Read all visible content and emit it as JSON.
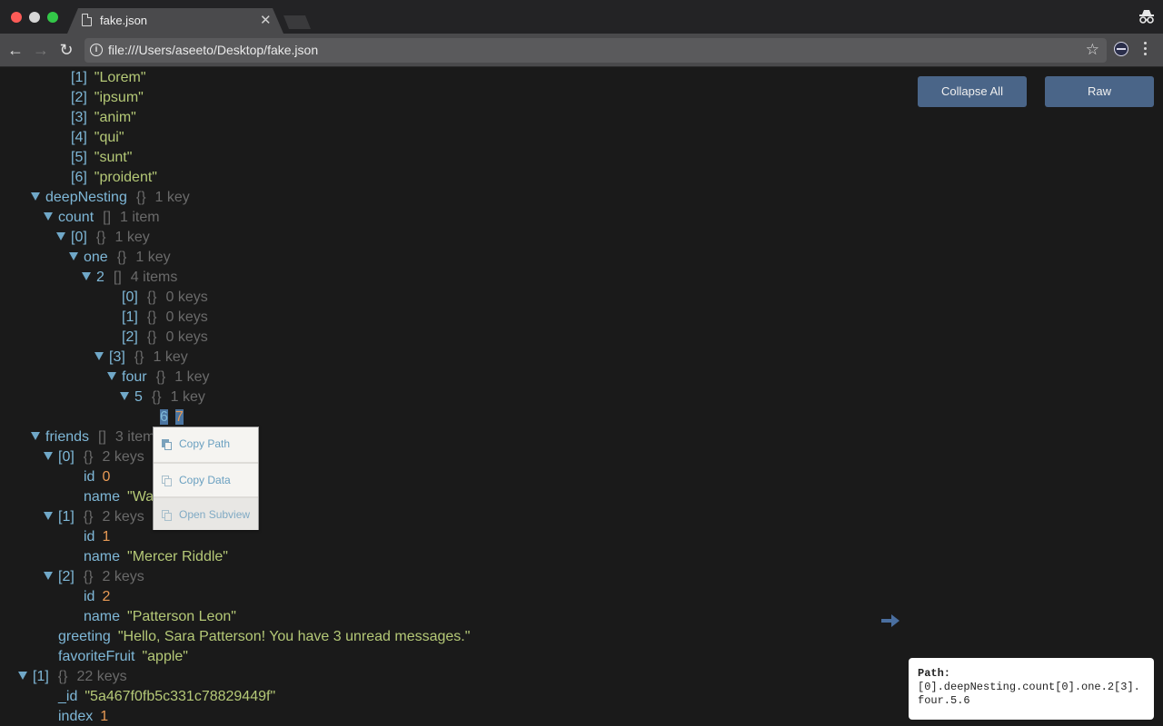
{
  "browser": {
    "tab_title": "fake.json",
    "url": "file:///Users/aseeto/Desktop/fake.json",
    "icons": [
      "back-arrow-icon",
      "forward-arrow-icon",
      "reload-icon",
      "info-icon",
      "star-icon",
      "extension-icon",
      "menu-dots-icon",
      "incognito-icon",
      "file-icon",
      "close-icon"
    ]
  },
  "actions": {
    "collapse_all": "Collapse All",
    "raw": "Raw"
  },
  "tree": [
    {
      "indent": 4,
      "caret": false,
      "key": "[1]",
      "value": "\"Lorem\"",
      "vtype": "str"
    },
    {
      "indent": 4,
      "caret": false,
      "key": "[2]",
      "value": "\"ipsum\"",
      "vtype": "str"
    },
    {
      "indent": 4,
      "caret": false,
      "key": "[3]",
      "value": "\"anim\"",
      "vtype": "str"
    },
    {
      "indent": 4,
      "caret": false,
      "key": "[4]",
      "value": "\"qui\"",
      "vtype": "str"
    },
    {
      "indent": 4,
      "caret": false,
      "key": "[5]",
      "value": "\"sunt\"",
      "vtype": "str"
    },
    {
      "indent": 4,
      "caret": false,
      "key": "[6]",
      "value": "\"proident\"",
      "vtype": "str"
    },
    {
      "indent": 2,
      "caret": true,
      "key": "deepNesting",
      "bracket": "{}",
      "count": "1 key"
    },
    {
      "indent": 3,
      "caret": true,
      "key": "count",
      "bracket": "[]",
      "count": "1 item"
    },
    {
      "indent": 4,
      "caret": true,
      "key": "[0]",
      "bracket": "{}",
      "count": "1 key"
    },
    {
      "indent": 5,
      "caret": true,
      "key": "one",
      "bracket": "{}",
      "count": "1 key"
    },
    {
      "indent": 6,
      "caret": true,
      "key": "2",
      "bracket": "[]",
      "count": "4 items"
    },
    {
      "indent": 8,
      "caret": false,
      "key": "[0]",
      "bracket": "{}",
      "count": "0 keys"
    },
    {
      "indent": 8,
      "caret": false,
      "key": "[1]",
      "bracket": "{}",
      "count": "0 keys"
    },
    {
      "indent": 8,
      "caret": false,
      "key": "[2]",
      "bracket": "{}",
      "count": "0 keys"
    },
    {
      "indent": 7,
      "caret": true,
      "key": "[3]",
      "bracket": "{}",
      "count": "1 key"
    },
    {
      "indent": 8,
      "caret": true,
      "key": "four",
      "bracket": "{}",
      "count": "1 key"
    },
    {
      "indent": 9,
      "caret": true,
      "key": "5",
      "bracket": "{}",
      "count": "1 key"
    },
    {
      "indent": 11,
      "caret": false,
      "key": "6",
      "value": "7",
      "vtype": "num",
      "selected": true
    },
    {
      "indent": 2,
      "caret": true,
      "key": "friends",
      "bracket": "[]",
      "count": "3 items"
    },
    {
      "indent": 3,
      "caret": true,
      "key": "[0]",
      "bracket": "{}",
      "count": "2 keys"
    },
    {
      "indent": 5,
      "caret": false,
      "key": "id",
      "value": "0",
      "vtype": "num"
    },
    {
      "indent": 5,
      "caret": false,
      "key": "name",
      "value": "\"Walker\"",
      "vtype": "str"
    },
    {
      "indent": 3,
      "caret": true,
      "key": "[1]",
      "bracket": "{}",
      "count": "2 keys"
    },
    {
      "indent": 5,
      "caret": false,
      "key": "id",
      "value": "1",
      "vtype": "num"
    },
    {
      "indent": 5,
      "caret": false,
      "key": "name",
      "value": "\"Mercer Riddle\"",
      "vtype": "str"
    },
    {
      "indent": 3,
      "caret": true,
      "key": "[2]",
      "bracket": "{}",
      "count": "2 keys"
    },
    {
      "indent": 5,
      "caret": false,
      "key": "id",
      "value": "2",
      "vtype": "num"
    },
    {
      "indent": 5,
      "caret": false,
      "key": "name",
      "value": "\"Patterson Leon\"",
      "vtype": "str"
    },
    {
      "indent": 3,
      "caret": false,
      "key": "greeting",
      "value": "\"Hello, Sara Patterson! You have 3 unread messages.\"",
      "vtype": "str"
    },
    {
      "indent": 3,
      "caret": false,
      "key": "favoriteFruit",
      "value": "\"apple\"",
      "vtype": "str"
    },
    {
      "indent": 1,
      "caret": true,
      "key": "[1]",
      "bracket": "{}",
      "count": "22 keys"
    },
    {
      "indent": 3,
      "caret": false,
      "key": "_id",
      "value": "\"5a467f0fb5c331c78829449f\"",
      "vtype": "str"
    },
    {
      "indent": 3,
      "caret": false,
      "key": "index",
      "value": "1",
      "vtype": "num"
    }
  ],
  "context_menu": {
    "items": [
      {
        "label": "Copy Path",
        "icon": "copy-path-icon"
      },
      {
        "label": "Copy Data",
        "icon": "copy-data-icon"
      },
      {
        "label": "Open Subview",
        "icon": "open-subview-icon"
      }
    ]
  },
  "path_tooltip": {
    "label": "Path:",
    "value": "[0].deepNesting.count[0].one.2[3].four.5.6"
  },
  "colors": {
    "key": "#7fb8d8",
    "string": "#b5c977",
    "number": "#e89a55",
    "meta": "#6a6a6a",
    "button": "#4a6588",
    "background": "#1a1a1a"
  }
}
